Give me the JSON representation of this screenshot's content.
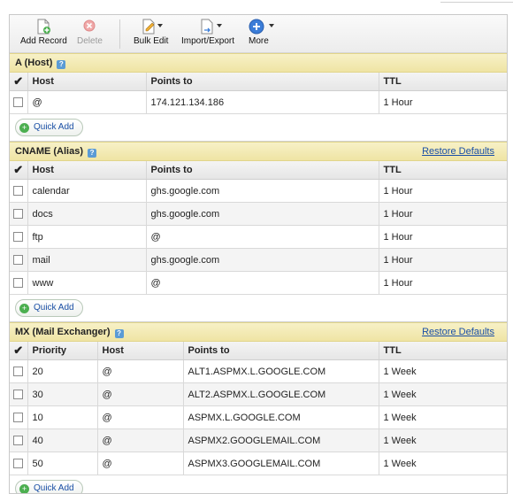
{
  "toolbar": {
    "add_record": "Add Record",
    "delete": "Delete",
    "bulk_edit": "Bulk Edit",
    "import_export": "Import/Export",
    "more": "More"
  },
  "colors": {
    "section_header": "#f2e8b0",
    "link": "#1a4fa6",
    "quick_add_icon": "#4caf50",
    "more_icon": "#3b7dd8"
  },
  "a_section": {
    "title": "A (Host)",
    "columns": [
      "Host",
      "Points to",
      "TTL"
    ],
    "rows": [
      {
        "host": "@",
        "points_to": "174.121.134.186",
        "ttl": "1 Hour"
      }
    ],
    "quick_add": "Quick Add"
  },
  "cname_section": {
    "title": "CNAME (Alias)",
    "restore": "Restore Defaults",
    "columns": [
      "Host",
      "Points to",
      "TTL"
    ],
    "rows": [
      {
        "host": "calendar",
        "points_to": "ghs.google.com",
        "ttl": "1 Hour"
      },
      {
        "host": "docs",
        "points_to": "ghs.google.com",
        "ttl": "1 Hour"
      },
      {
        "host": "ftp",
        "points_to": "@",
        "ttl": "1 Hour"
      },
      {
        "host": "mail",
        "points_to": "ghs.google.com",
        "ttl": "1 Hour"
      },
      {
        "host": "www",
        "points_to": "@",
        "ttl": "1 Hour"
      }
    ],
    "quick_add": "Quick Add"
  },
  "mx_section": {
    "title": "MX (Mail Exchanger)",
    "restore": "Restore Defaults",
    "columns": [
      "Priority",
      "Host",
      "Points to",
      "TTL"
    ],
    "rows": [
      {
        "priority": "20",
        "host": "@",
        "points_to": "ALT1.ASPMX.L.GOOGLE.COM",
        "ttl": "1 Week"
      },
      {
        "priority": "30",
        "host": "@",
        "points_to": "ALT2.ASPMX.L.GOOGLE.COM",
        "ttl": "1 Week"
      },
      {
        "priority": "10",
        "host": "@",
        "points_to": "ASPMX.L.GOOGLE.COM",
        "ttl": "1 Week"
      },
      {
        "priority": "40",
        "host": "@",
        "points_to": "ASPMX2.GOOGLEMAIL.COM",
        "ttl": "1 Week"
      },
      {
        "priority": "50",
        "host": "@",
        "points_to": "ASPMX3.GOOGLEMAIL.COM",
        "ttl": "1 Week"
      }
    ],
    "quick_add": "Quick Add"
  }
}
